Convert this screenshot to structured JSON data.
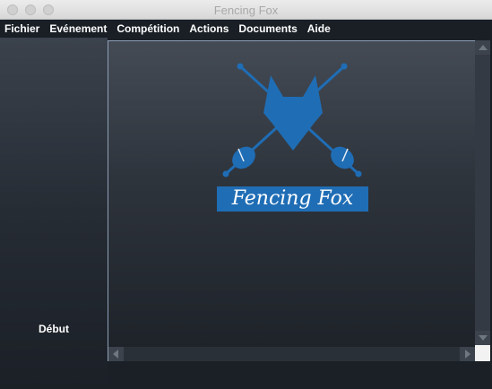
{
  "window": {
    "title": "Fencing Fox"
  },
  "menu": {
    "items": [
      "Fichier",
      "Evénement",
      "Compétition",
      "Actions",
      "Documents",
      "Aide"
    ]
  },
  "sidebar": {
    "start_label": "Début"
  },
  "logo": {
    "text": "Fencing Fox",
    "color": "#1f6db5"
  },
  "colors": {
    "background": "#1a1f26",
    "accent": "#1f6db5",
    "panel_border": "#8fa0b8"
  }
}
